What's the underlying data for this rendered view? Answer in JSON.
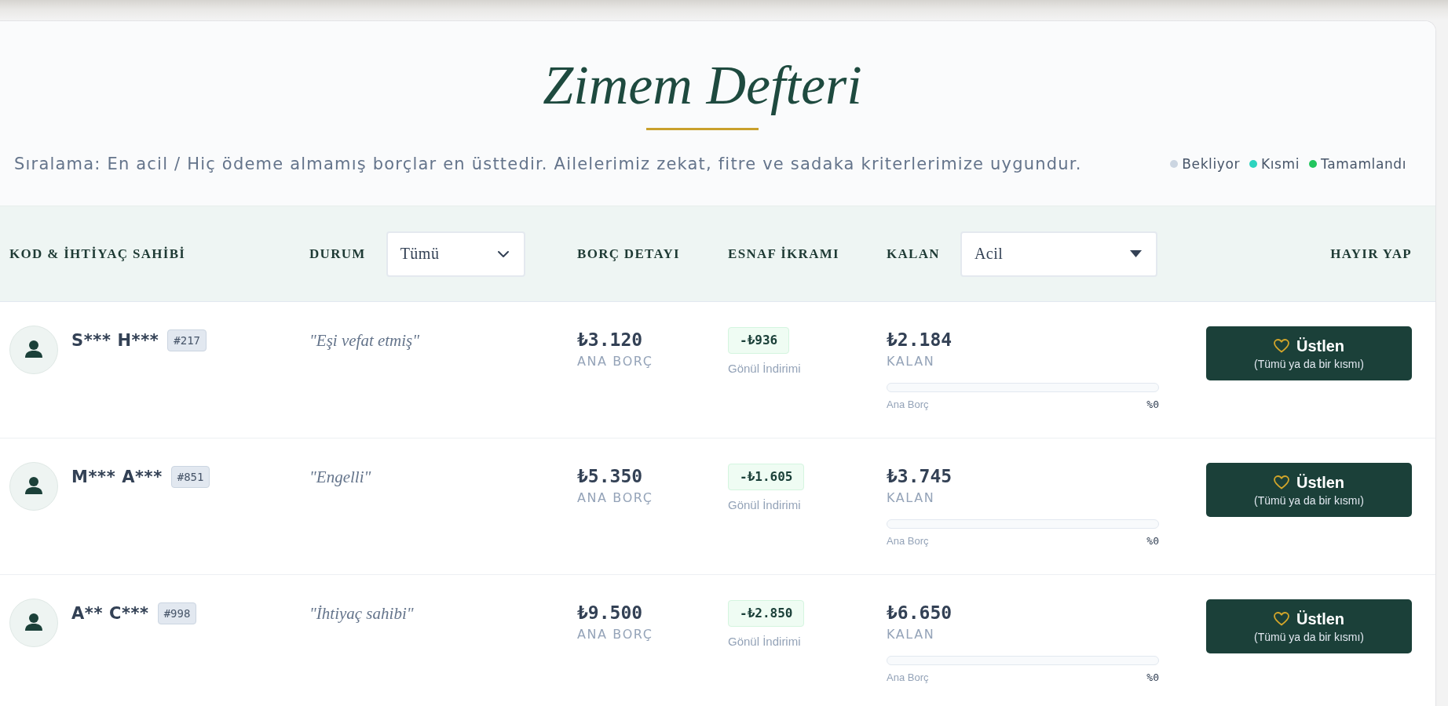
{
  "title": "Zimem Defteri",
  "subtitle": "Sıralama: En acil / Hiç ödeme almamış borçlar en üsttedir. Ailelerimiz zekat, fitre ve sadaka kriterlerimize uygundur.",
  "legend": [
    {
      "label": "Bekliyor",
      "color": "#cbd5e1"
    },
    {
      "label": "Kısmi",
      "color": "#2dd4bf"
    },
    {
      "label": "Tamamlandı",
      "color": "#22c55e"
    }
  ],
  "table": {
    "columns": [
      {
        "label": "KOD & İHTİYAÇ SAHİBİ",
        "kind": "plain"
      },
      {
        "label": "DURUM",
        "kind": "filter",
        "select": {
          "value": "Tümü"
        }
      },
      {
        "label": "BORÇ DETAYI",
        "kind": "plain"
      },
      {
        "label": "ESNAF İKRAMI",
        "kind": "plain"
      },
      {
        "label": "KALAN",
        "kind": "sort",
        "select": {
          "value": "Acil"
        }
      },
      {
        "label": "HAYIR YAP",
        "kind": "plain"
      }
    ],
    "rows": [
      {
        "name": "S*** H***",
        "code": "#217",
        "note": "\"Eşi vefat etmiş\"",
        "debt": {
          "amount": "₺3.120",
          "label": "ANA BORÇ"
        },
        "discount": {
          "amount": "-₺936",
          "label": "Gönül İndirimi"
        },
        "remaining": {
          "amount": "₺2.184",
          "label": "KALAN"
        },
        "progress": {
          "level": 0,
          "label": "Ana Borç",
          "reading": "%0"
        },
        "action": {
          "label": "Üstlen",
          "note": "(Tümü ya da bir kısmı)"
        }
      },
      {
        "name": "M*** A***",
        "code": "#851",
        "note": "\"Engelli\"",
        "debt": {
          "amount": "₺5.350",
          "label": "ANA BORÇ"
        },
        "discount": {
          "amount": "-₺1.605",
          "label": "Gönül İndirimi"
        },
        "remaining": {
          "amount": "₺3.745",
          "label": "KALAN"
        },
        "progress": {
          "level": 0,
          "label": "Ana Borç",
          "reading": "%0"
        },
        "action": {
          "label": "Üstlen",
          "note": "(Tümü ya da bir kısmı)"
        }
      },
      {
        "name": "A** C***",
        "code": "#998",
        "note": "\"İhtiyaç sahibi\"",
        "debt": {
          "amount": "₺9.500",
          "label": "ANA BORÇ"
        },
        "discount": {
          "amount": "-₺2.850",
          "label": "Gönül İndirimi"
        },
        "remaining": {
          "amount": "₺6.650",
          "label": "KALAN"
        },
        "progress": {
          "level": 0,
          "label": "Ana Borç",
          "reading": "%0"
        },
        "action": {
          "label": "Üstlen",
          "note": "(Tümü ya da bir kısmı)"
        }
      }
    ]
  }
}
